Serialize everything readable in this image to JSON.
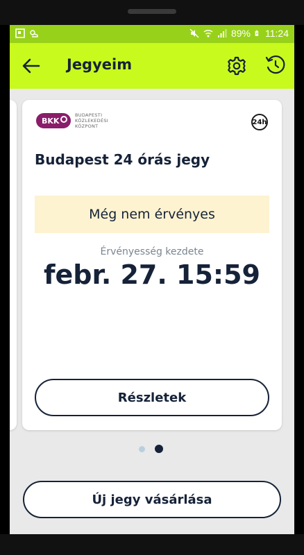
{
  "status_bar": {
    "battery": "89%",
    "time": "11:24"
  },
  "app_bar": {
    "title": "Jegyeim"
  },
  "ticket": {
    "issuer_lines": [
      "BUDAPESTI",
      "KÖZLEKEDÉSI",
      "KÖZPONT"
    ],
    "issuer_logo_text": "BKK",
    "duration_badge": "24h",
    "name": "Budapest 24 órás jegy",
    "status": "Még nem érvényes",
    "valid_from_label": "Érvényesség kezdete",
    "valid_from_value": "febr. 27. 15:59",
    "details_button": "Részletek"
  },
  "pager": {
    "count": 2,
    "active_index": 1
  },
  "actions": {
    "buy_button": "Új jegy vásárlása"
  },
  "colors": {
    "accent": "#c9fa1e",
    "status_bar": "#98d11a",
    "text_dark": "#152238",
    "banner_bg": "#fdf3d0",
    "bkk_purple": "#8a1d6a"
  },
  "icons": {
    "back": "arrow-left-icon",
    "settings": "gear-icon",
    "history": "history-clock-icon"
  }
}
